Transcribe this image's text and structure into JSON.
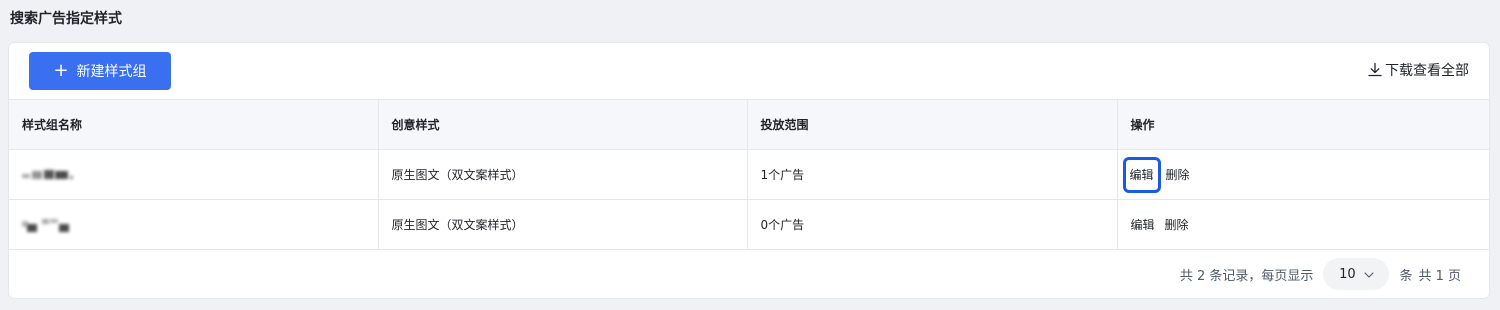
{
  "page": {
    "title": "搜索广告指定样式"
  },
  "toolbar": {
    "new_button_label": "新建样式组",
    "new_button_icon": "plus-icon",
    "download_label": "下载查看全部",
    "download_icon": "download-icon",
    "accent_color": "#3a6ff0"
  },
  "table": {
    "columns": [
      "样式组名称",
      "创意样式",
      "投放范围",
      "操作"
    ],
    "rows": [
      {
        "name": "",
        "creative_style": "原生图文（双文案样式）",
        "scope": "1个广告",
        "actions": [
          "编辑",
          "删除"
        ],
        "highlighted_action": "编辑"
      },
      {
        "name": "",
        "creative_style": "原生图文（双文案样式）",
        "scope": "0个广告",
        "actions": [
          "编辑",
          "删除"
        ]
      }
    ]
  },
  "pagination": {
    "total_text": "共 2 条记录，每页显示",
    "page_size": "10",
    "unit_text": "条",
    "pages_text": "共 1 页"
  }
}
